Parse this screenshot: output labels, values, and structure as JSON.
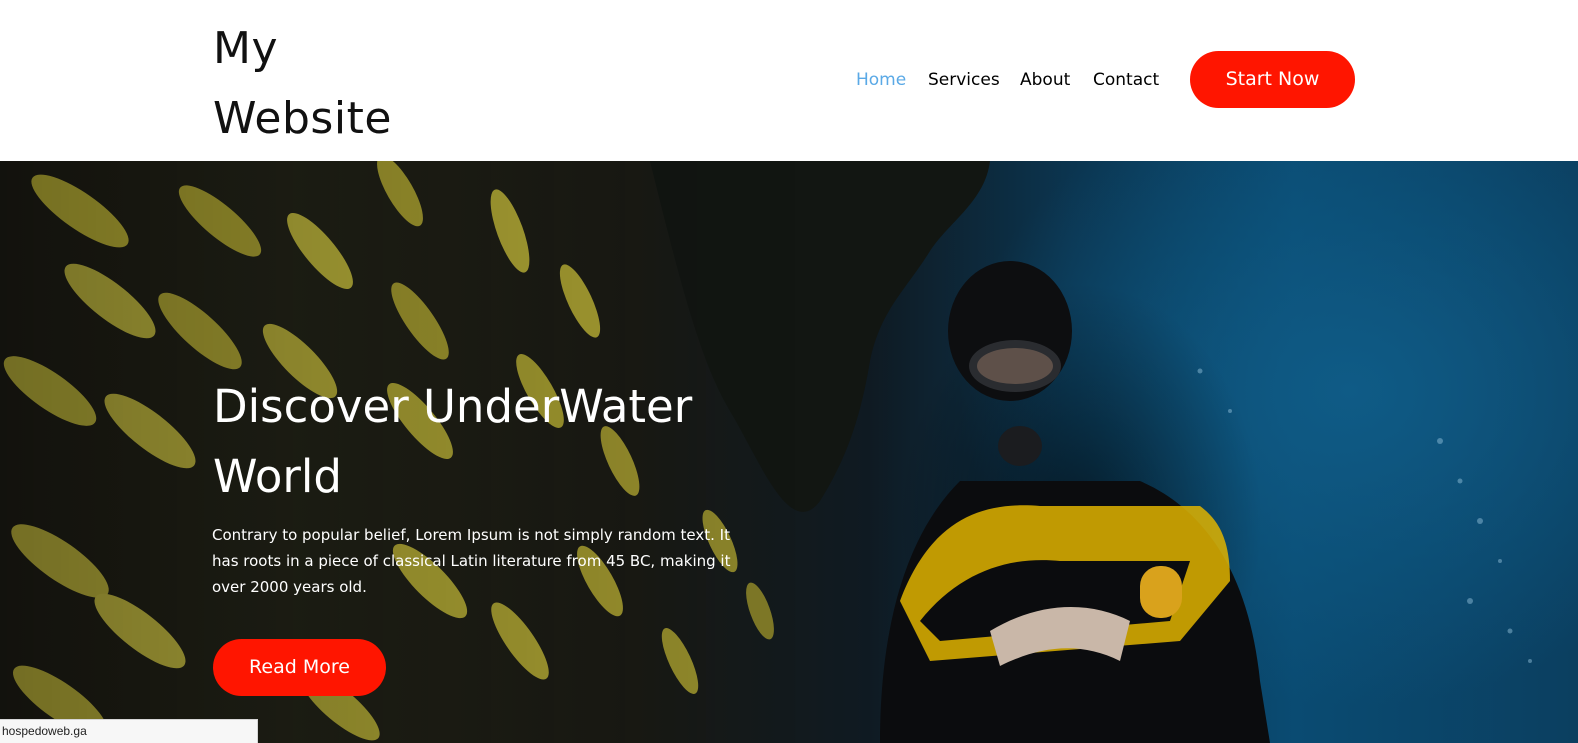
{
  "header": {
    "logo_line1": "My",
    "logo_line2": "Website",
    "nav": [
      {
        "label": "Home",
        "active": true
      },
      {
        "label": "Services",
        "active": false
      },
      {
        "label": "About",
        "active": false
      },
      {
        "label": "Contact",
        "active": false
      }
    ],
    "cta_label": "Start Now"
  },
  "hero": {
    "title_line1": "Discover UnderWater",
    "title_line2": "World",
    "text_line1": "Contrary to popular belief, Lorem Ipsum is not simply random text. It",
    "text_line2": "has roots in a piece of classical Latin literature from 45 BC, making it",
    "text_line3": "over 2000 years old.",
    "button_label": "Read More",
    "image": "underwater-diver-with-yellow-fish-school"
  },
  "status_bar": {
    "url": "hospedoweb.ga"
  },
  "colors": {
    "accent": "#ff1500",
    "nav_active": "#5aa9e6",
    "text": "#000000"
  }
}
